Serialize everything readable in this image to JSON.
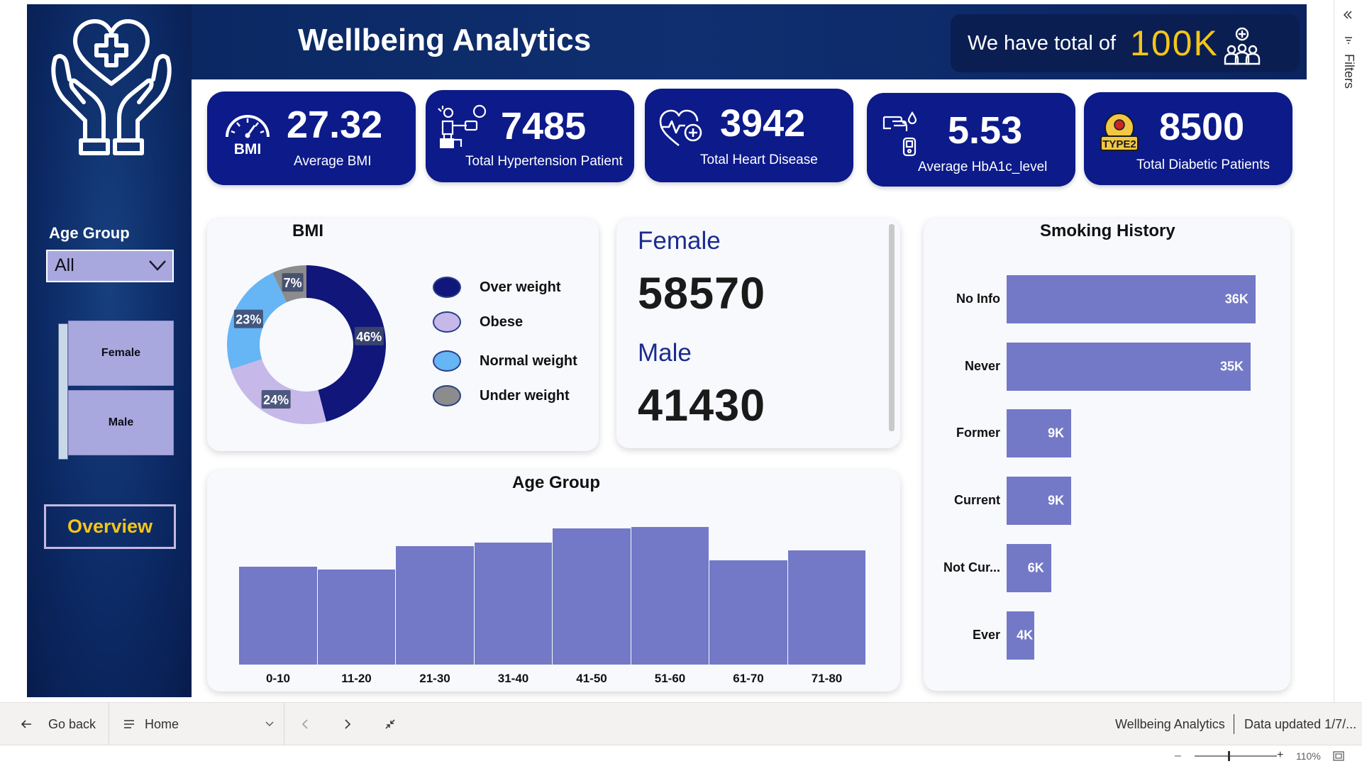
{
  "header": {
    "title": "Wellbeing Analytics",
    "total_text": "We have total of",
    "total_value": "100K"
  },
  "kpis": [
    {
      "value": "27.32",
      "label": "Average BMI",
      "icon": "bmi-gauge-icon",
      "icon_text": "BMI"
    },
    {
      "value": "7485",
      "label": "Total Hypertension Patient",
      "icon": "hypertension-icon"
    },
    {
      "value": "3942",
      "label": "Total Heart Disease",
      "icon": "heart-pulse-icon"
    },
    {
      "value": "5.53",
      "label": "Average HbA1c_level",
      "icon": "glucose-test-icon"
    },
    {
      "value": "8500",
      "label": "Total Diabetic Patients",
      "icon": "type2-diabetes-icon",
      "icon_text": "TYPE2"
    }
  ],
  "sidebar": {
    "age_group_label": "Age Group",
    "age_group_selected": "All",
    "gender_buttons": [
      "Female",
      "Male"
    ],
    "overview_label": "Overview"
  },
  "bmi_panel": {
    "title": "BMI",
    "legend": [
      "Over weight",
      "Obese",
      "Normal weight",
      "Under weight"
    ]
  },
  "gender_panel": {
    "female_label": "Female",
    "female_value": "58570",
    "male_label": "Male",
    "male_value": "41430"
  },
  "age_panel": {
    "title": "Age Group"
  },
  "smoking_panel": {
    "title": "Smoking History"
  },
  "chart_data": [
    {
      "type": "pie",
      "title": "BMI",
      "categories": [
        "Over weight",
        "Obese",
        "Normal weight",
        "Under weight"
      ],
      "values": [
        46,
        24,
        23,
        7
      ],
      "labels": [
        "46%",
        "24%",
        "23%",
        "7%"
      ],
      "colors": [
        "#11167a",
        "#c6b8e8",
        "#66b5f5",
        "#8c8c8c"
      ],
      "legend": "right"
    },
    {
      "type": "bar",
      "title": "Age Group",
      "categories": [
        "0-10",
        "11-20",
        "21-30",
        "31-40",
        "41-50",
        "51-60",
        "61-70",
        "71-80"
      ],
      "values": [
        10800,
        10500,
        13100,
        13500,
        15000,
        15200,
        11500,
        12600
      ],
      "ylim": [
        0,
        18000
      ],
      "grid": false
    },
    {
      "type": "bar",
      "orientation": "horizontal",
      "title": "Smoking History",
      "categories": [
        "No Info",
        "Never",
        "Former",
        "Current",
        "Not Cur...",
        "Ever"
      ],
      "values": [
        35.8,
        35.1,
        9.3,
        9.3,
        6.4,
        4.0
      ],
      "labels": [
        "36K",
        "35K",
        "9K",
        "9K",
        "6K",
        "4K"
      ],
      "xlim": [
        0,
        40
      ],
      "grid": false
    }
  ],
  "bottom_nav": {
    "go_back": "Go back",
    "page": "Home",
    "report_name": "Wellbeing Analytics",
    "data_updated": "Data updated 1/7/..."
  },
  "status": {
    "zoom": "110%"
  },
  "filters_pane": {
    "label": "Filters"
  },
  "colors": {
    "navy": "#0c1a8a",
    "accent_yellow": "#f5c518",
    "bar": "#7379c6",
    "header_bg": "#0b2863"
  }
}
